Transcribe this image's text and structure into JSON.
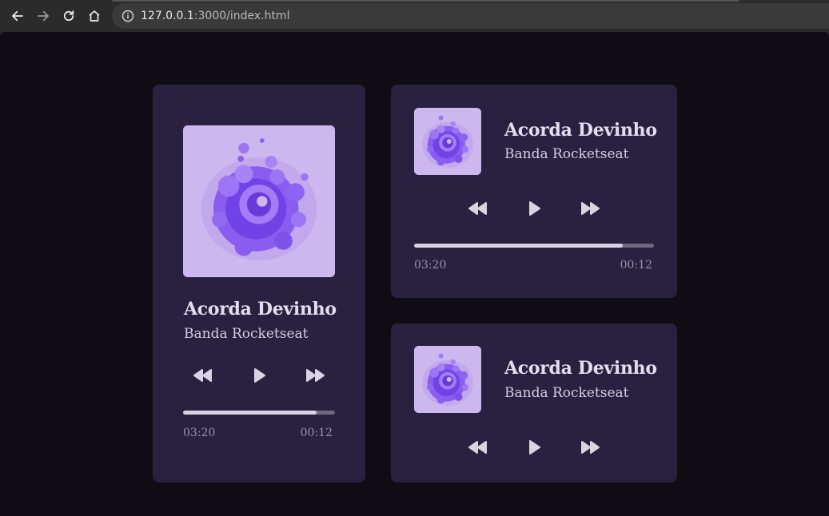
{
  "browser": {
    "url_host": "127.0.0.1",
    "url_path": ":3000/index.html"
  },
  "players": [
    {
      "title": "Acorda Devinho",
      "artist": "Banda Rocketseat",
      "progress": 0.88,
      "time_left": "03:20",
      "time_right": "00:12"
    },
    {
      "title": "Acorda Devinho",
      "artist": "Banda Rocketseat",
      "progress": 0.87,
      "time_left": "03:20",
      "time_right": "00:12"
    },
    {
      "title": "Acorda Devinho",
      "artist": "Banda Rocketseat"
    }
  ],
  "icons": {
    "back": "arrow-left-icon",
    "forward": "arrow-right-icon",
    "reload": "reload-icon",
    "home": "home-icon",
    "info": "info-icon",
    "rewind": "rewind-icon",
    "play": "play-icon",
    "fast_forward": "fast-forward-icon"
  },
  "colors": {
    "page_bg": "#0f0d13",
    "card_bg": "#2a2140",
    "cover_bg": "#cdb7ef",
    "accent": "#8257e5"
  }
}
